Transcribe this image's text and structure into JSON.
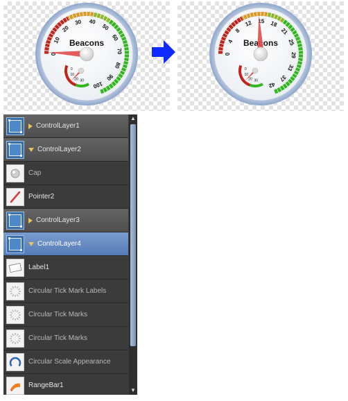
{
  "gauges": [
    {
      "title": "Beacons",
      "scale_labels": [
        "0",
        "10",
        "20",
        "30",
        "40",
        "50",
        "60",
        "70",
        "80",
        "90",
        "100"
      ],
      "inner_labels": [
        "0",
        "10",
        "20",
        "30"
      ],
      "pointer_value_fraction": 0.01
    },
    {
      "title": "Beacons",
      "scale_labels": [
        "0",
        "4",
        "8",
        "12",
        "15",
        "18",
        "21",
        "25",
        "29",
        "33",
        "37",
        "42"
      ],
      "inner_labels": [
        "0",
        "10",
        "20",
        "30"
      ],
      "pointer_value_fraction": 0.35
    }
  ],
  "colors": {
    "scale_red": "#c2241a",
    "scale_green": "#33b51f",
    "pointer": "#e24a4a",
    "arrow": "#0f2bff",
    "selected_row": "#5f83bd",
    "panel_bg": "#3c3c3c"
  },
  "arrow_icon": "right-arrow-icon",
  "layers": [
    {
      "label": "ControlLayer1",
      "kind": "layer",
      "expanded": false,
      "icon": "control-layer-icon"
    },
    {
      "label": "ControlLayer2",
      "kind": "layer",
      "expanded": true,
      "icon": "control-layer-icon"
    },
    {
      "label": "Cap",
      "kind": "child",
      "icon": "cap-icon"
    },
    {
      "label": "Pointer2",
      "kind": "child",
      "icon": "pointer-icon"
    },
    {
      "label": "ControlLayer3",
      "kind": "layer",
      "expanded": false,
      "icon": "control-layer-icon"
    },
    {
      "label": "ControlLayer4",
      "kind": "layer",
      "expanded": true,
      "selected": true,
      "icon": "control-layer-icon"
    },
    {
      "label": "Label1",
      "kind": "child",
      "icon": "label-icon"
    },
    {
      "label": "Circular Tick Mark Labels",
      "kind": "child",
      "icon": "tick-mark-labels-icon"
    },
    {
      "label": "Circular Tick Marks",
      "kind": "child",
      "icon": "tick-marks-icon"
    },
    {
      "label": "Circular Tick Marks",
      "kind": "child",
      "icon": "tick-marks-icon"
    },
    {
      "label": "Circular Scale Appearance",
      "kind": "child",
      "icon": "scale-appearance-icon"
    },
    {
      "label": "RangeBar1",
      "kind": "child",
      "icon": "range-bar-icon"
    }
  ],
  "scrollbar": {
    "up_icon": "scroll-up-icon",
    "down_icon": "scroll-down-icon"
  }
}
